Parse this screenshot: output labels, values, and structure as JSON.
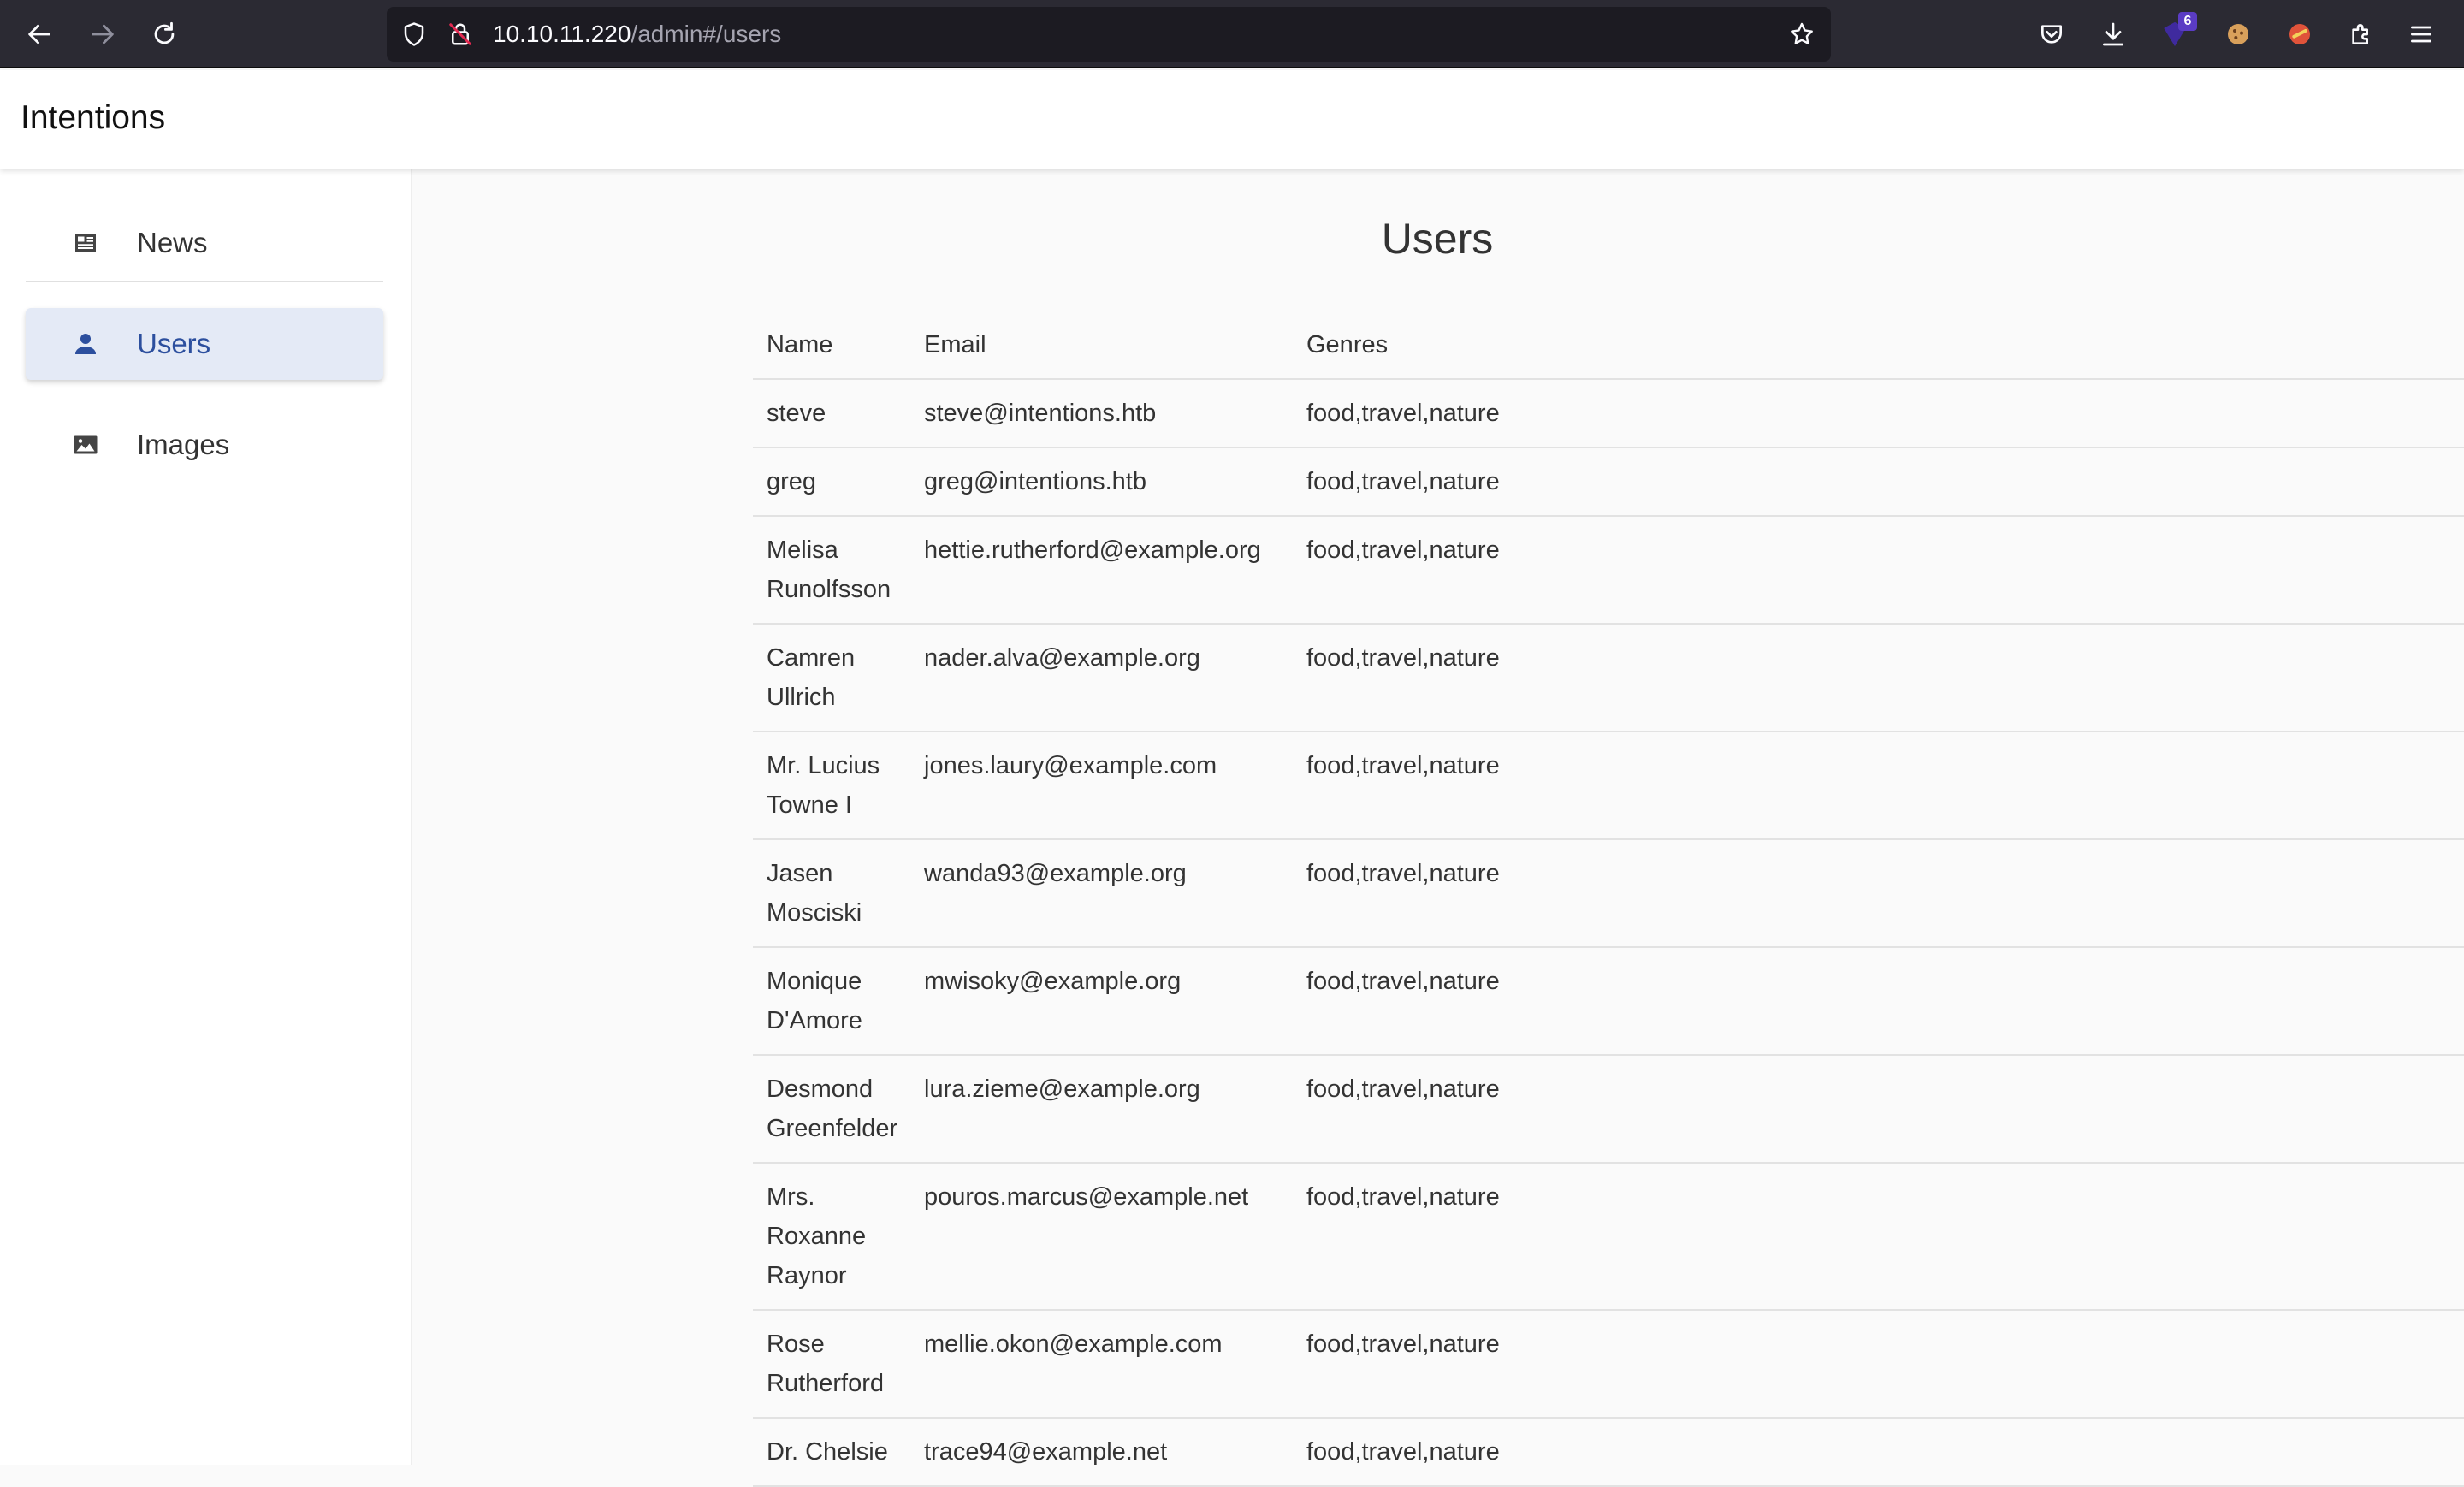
{
  "browser": {
    "url_host": "10.10.11.220",
    "url_path": "/admin#/users",
    "extension_badge": "6"
  },
  "app": {
    "title": "Intentions"
  },
  "sidebar": {
    "items": [
      {
        "label": "News",
        "icon": "newspaper-icon",
        "active": false
      },
      {
        "label": "Users",
        "icon": "person-icon",
        "active": true
      },
      {
        "label": "Images",
        "icon": "image-icon",
        "active": false
      }
    ]
  },
  "main": {
    "title": "Users",
    "columns": [
      "Name",
      "Email",
      "Genres"
    ],
    "rows": [
      {
        "name": "steve",
        "email": "steve@intentions.htb",
        "genres": "food,travel,nature"
      },
      {
        "name": "greg",
        "email": "greg@intentions.htb",
        "genres": "food,travel,nature"
      },
      {
        "name": "Melisa Runolfsson",
        "email": "hettie.rutherford@example.org",
        "genres": "food,travel,nature"
      },
      {
        "name": "Camren Ullrich",
        "email": "nader.alva@example.org",
        "genres": "food,travel,nature"
      },
      {
        "name": "Mr. Lucius Towne I",
        "email": "jones.laury@example.com",
        "genres": "food,travel,nature"
      },
      {
        "name": "Jasen Mosciski",
        "email": "wanda93@example.org",
        "genres": "food,travel,nature"
      },
      {
        "name": "Monique D'Amore",
        "email": "mwisoky@example.org",
        "genres": "food,travel,nature"
      },
      {
        "name": "Desmond Greenfelder",
        "email": "lura.zieme@example.org",
        "genres": "food,travel,nature"
      },
      {
        "name": "Mrs. Roxanne Raynor",
        "email": "pouros.marcus@example.net",
        "genres": "food,travel,nature"
      },
      {
        "name": "Rose Rutherford",
        "email": "mellie.okon@example.com",
        "genres": "food,travel,nature"
      },
      {
        "name": "Dr. Chelsie",
        "email": "trace94@example.net",
        "genres": "food,travel,nature"
      }
    ]
  },
  "colors": {
    "toolbar_bg": "#2b2a33",
    "urlbar_bg": "#1c1b22",
    "active_nav_bg": "#e4eaf6",
    "active_nav_text": "#2c4f9e",
    "page_bg": "#fafafa"
  }
}
